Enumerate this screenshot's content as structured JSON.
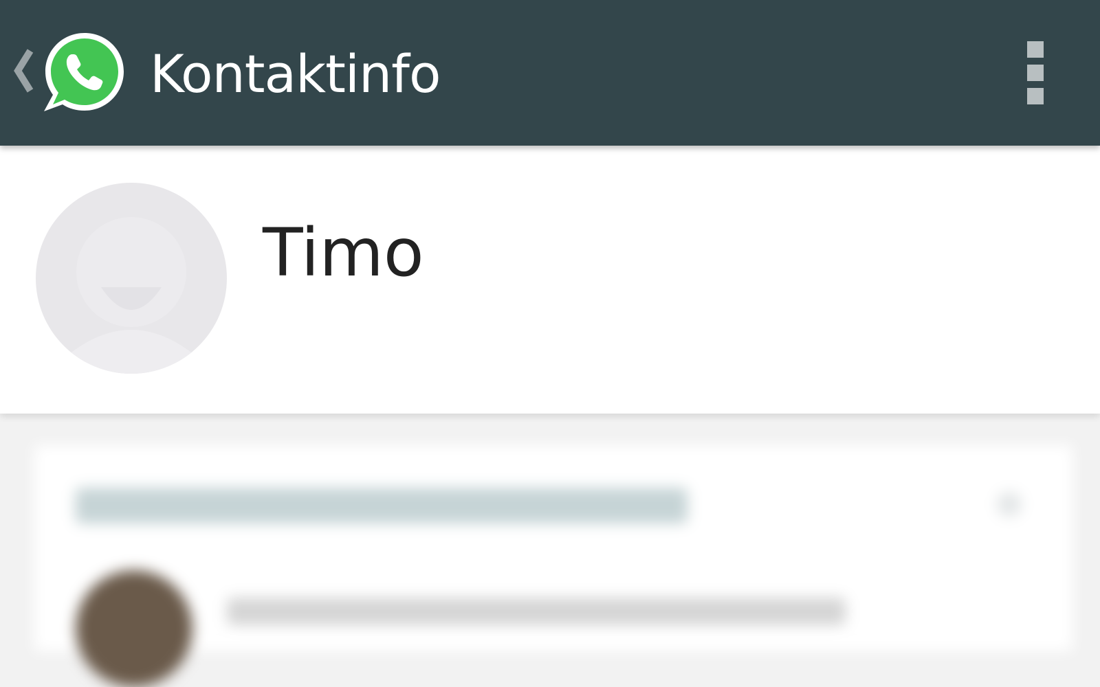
{
  "app_bar": {
    "title": "Kontaktinfo",
    "background_color": "#33464b",
    "back_icon": "chevron-left-icon",
    "logo_icon": "whatsapp-logo-icon",
    "logo_color": "#43c553",
    "menu_icon": "more-vertical-icon"
  },
  "contact": {
    "name": "Timo",
    "avatar_icon": "default-avatar-icon"
  },
  "blurred_section": {
    "heading_color": "#c6d4d6"
  }
}
